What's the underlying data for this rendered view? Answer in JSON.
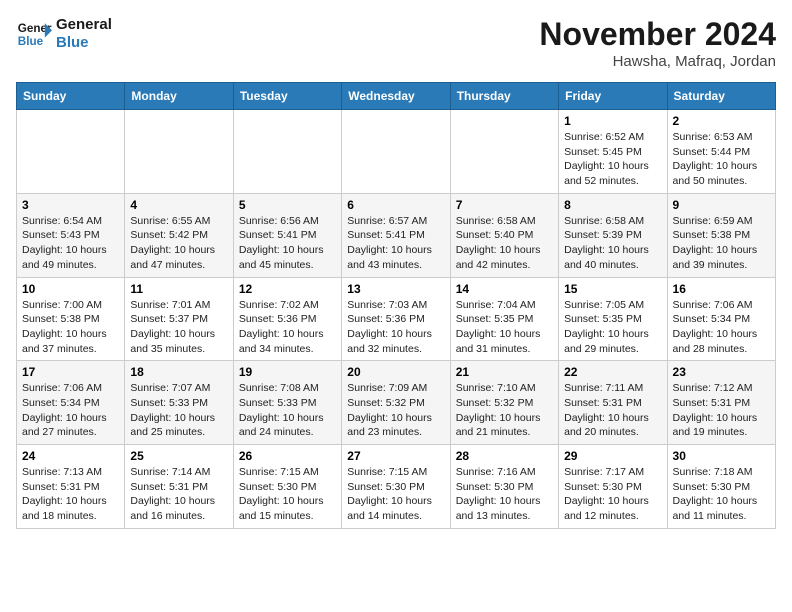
{
  "header": {
    "logo_line1": "General",
    "logo_line2": "Blue",
    "month": "November 2024",
    "location": "Hawsha, Mafraq, Jordan"
  },
  "weekdays": [
    "Sunday",
    "Monday",
    "Tuesday",
    "Wednesday",
    "Thursday",
    "Friday",
    "Saturday"
  ],
  "weeks": [
    [
      {
        "day": "",
        "info": ""
      },
      {
        "day": "",
        "info": ""
      },
      {
        "day": "",
        "info": ""
      },
      {
        "day": "",
        "info": ""
      },
      {
        "day": "",
        "info": ""
      },
      {
        "day": "1",
        "info": "Sunrise: 6:52 AM\nSunset: 5:45 PM\nDaylight: 10 hours\nand 52 minutes."
      },
      {
        "day": "2",
        "info": "Sunrise: 6:53 AM\nSunset: 5:44 PM\nDaylight: 10 hours\nand 50 minutes."
      }
    ],
    [
      {
        "day": "3",
        "info": "Sunrise: 6:54 AM\nSunset: 5:43 PM\nDaylight: 10 hours\nand 49 minutes."
      },
      {
        "day": "4",
        "info": "Sunrise: 6:55 AM\nSunset: 5:42 PM\nDaylight: 10 hours\nand 47 minutes."
      },
      {
        "day": "5",
        "info": "Sunrise: 6:56 AM\nSunset: 5:41 PM\nDaylight: 10 hours\nand 45 minutes."
      },
      {
        "day": "6",
        "info": "Sunrise: 6:57 AM\nSunset: 5:41 PM\nDaylight: 10 hours\nand 43 minutes."
      },
      {
        "day": "7",
        "info": "Sunrise: 6:58 AM\nSunset: 5:40 PM\nDaylight: 10 hours\nand 42 minutes."
      },
      {
        "day": "8",
        "info": "Sunrise: 6:58 AM\nSunset: 5:39 PM\nDaylight: 10 hours\nand 40 minutes."
      },
      {
        "day": "9",
        "info": "Sunrise: 6:59 AM\nSunset: 5:38 PM\nDaylight: 10 hours\nand 39 minutes."
      }
    ],
    [
      {
        "day": "10",
        "info": "Sunrise: 7:00 AM\nSunset: 5:38 PM\nDaylight: 10 hours\nand 37 minutes."
      },
      {
        "day": "11",
        "info": "Sunrise: 7:01 AM\nSunset: 5:37 PM\nDaylight: 10 hours\nand 35 minutes."
      },
      {
        "day": "12",
        "info": "Sunrise: 7:02 AM\nSunset: 5:36 PM\nDaylight: 10 hours\nand 34 minutes."
      },
      {
        "day": "13",
        "info": "Sunrise: 7:03 AM\nSunset: 5:36 PM\nDaylight: 10 hours\nand 32 minutes."
      },
      {
        "day": "14",
        "info": "Sunrise: 7:04 AM\nSunset: 5:35 PM\nDaylight: 10 hours\nand 31 minutes."
      },
      {
        "day": "15",
        "info": "Sunrise: 7:05 AM\nSunset: 5:35 PM\nDaylight: 10 hours\nand 29 minutes."
      },
      {
        "day": "16",
        "info": "Sunrise: 7:06 AM\nSunset: 5:34 PM\nDaylight: 10 hours\nand 28 minutes."
      }
    ],
    [
      {
        "day": "17",
        "info": "Sunrise: 7:06 AM\nSunset: 5:34 PM\nDaylight: 10 hours\nand 27 minutes."
      },
      {
        "day": "18",
        "info": "Sunrise: 7:07 AM\nSunset: 5:33 PM\nDaylight: 10 hours\nand 25 minutes."
      },
      {
        "day": "19",
        "info": "Sunrise: 7:08 AM\nSunset: 5:33 PM\nDaylight: 10 hours\nand 24 minutes."
      },
      {
        "day": "20",
        "info": "Sunrise: 7:09 AM\nSunset: 5:32 PM\nDaylight: 10 hours\nand 23 minutes."
      },
      {
        "day": "21",
        "info": "Sunrise: 7:10 AM\nSunset: 5:32 PM\nDaylight: 10 hours\nand 21 minutes."
      },
      {
        "day": "22",
        "info": "Sunrise: 7:11 AM\nSunset: 5:31 PM\nDaylight: 10 hours\nand 20 minutes."
      },
      {
        "day": "23",
        "info": "Sunrise: 7:12 AM\nSunset: 5:31 PM\nDaylight: 10 hours\nand 19 minutes."
      }
    ],
    [
      {
        "day": "24",
        "info": "Sunrise: 7:13 AM\nSunset: 5:31 PM\nDaylight: 10 hours\nand 18 minutes."
      },
      {
        "day": "25",
        "info": "Sunrise: 7:14 AM\nSunset: 5:31 PM\nDaylight: 10 hours\nand 16 minutes."
      },
      {
        "day": "26",
        "info": "Sunrise: 7:15 AM\nSunset: 5:30 PM\nDaylight: 10 hours\nand 15 minutes."
      },
      {
        "day": "27",
        "info": "Sunrise: 7:15 AM\nSunset: 5:30 PM\nDaylight: 10 hours\nand 14 minutes."
      },
      {
        "day": "28",
        "info": "Sunrise: 7:16 AM\nSunset: 5:30 PM\nDaylight: 10 hours\nand 13 minutes."
      },
      {
        "day": "29",
        "info": "Sunrise: 7:17 AM\nSunset: 5:30 PM\nDaylight: 10 hours\nand 12 minutes."
      },
      {
        "day": "30",
        "info": "Sunrise: 7:18 AM\nSunset: 5:30 PM\nDaylight: 10 hours\nand 11 minutes."
      }
    ]
  ]
}
